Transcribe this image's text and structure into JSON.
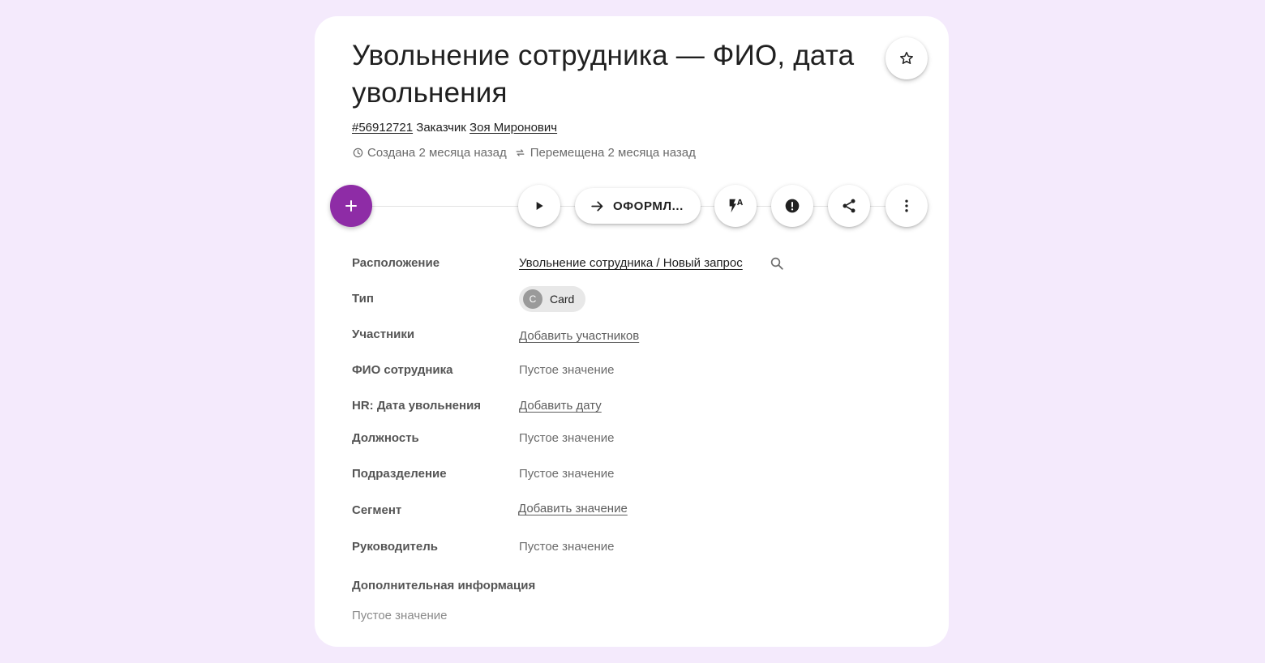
{
  "card": {
    "title": "Увольнение сотрудника — ФИО, дата увольнения",
    "id_link": "#56912721",
    "customer_label": "Заказчик",
    "customer_name": "Зоя Миронович",
    "created": "Создана 2 месяца назад",
    "moved": "Перемещена 2 месяца назад"
  },
  "toolbar": {
    "add_label": "+",
    "status_button": "ОФОРМЛ..."
  },
  "fields": {
    "location": {
      "label": "Расположение",
      "value": "Увольнение сотрудника / Новый запрос"
    },
    "type": {
      "label": "Тип",
      "avatar": "C",
      "value": "Card"
    },
    "participants": {
      "label": "Участники",
      "value": "Добавить участников"
    },
    "employee_name": {
      "label": "ФИО сотрудника",
      "value": "Пустое значение"
    },
    "dismissal_date": {
      "label": "HR: Дата увольнения",
      "value": "Добавить дату"
    },
    "position": {
      "label": "Должность",
      "value": "Пустое значение"
    },
    "department": {
      "label": "Подразделение",
      "value": "Пустое значение"
    },
    "segment": {
      "label": "Сегмент",
      "value": "Добавить значение"
    },
    "manager": {
      "label": "Руководитель",
      "value": "Пустое значение"
    }
  },
  "additional": {
    "label": "Дополнительная информация",
    "value": "Пустое значение"
  },
  "icons": {
    "favorite": "star-outline-icon",
    "play": "play-icon",
    "arrow": "arrow-right-icon",
    "automation": "flash-auto-icon",
    "priority": "alert-circle-icon",
    "share": "share-icon",
    "more": "more-vertical-icon",
    "search": "search-icon",
    "clock": "clock-icon",
    "move": "swap-icon"
  },
  "colors": {
    "background": "#f4eafc",
    "accent": "#8e2ca6",
    "card": "#ffffff"
  }
}
